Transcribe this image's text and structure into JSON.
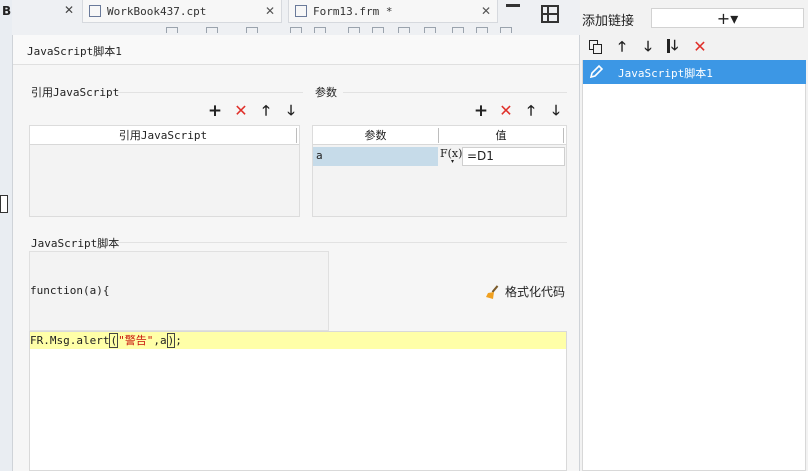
{
  "background": {
    "tabs": [
      {
        "label": "WorkBook437.cpt",
        "close": "✕"
      },
      {
        "label": "Form13.frm *",
        "close": "✕"
      }
    ],
    "left_letter": "B",
    "left_close": "✕"
  },
  "dialog": {
    "title": "JavaScript脚本1",
    "ref_section": {
      "label": "引用JavaScript",
      "column_header": "引用JavaScript"
    },
    "param_section": {
      "label": "参数",
      "columns": [
        "参数",
        "值"
      ],
      "rows": [
        {
          "name": "a",
          "formula_icon": "F(x)",
          "value": "=D1"
        }
      ]
    },
    "script_section": {
      "label": "JavaScript脚本",
      "function_header": "function(a){",
      "format_button": "格式化代码",
      "code_line": {
        "before": "FR.Msg.alert",
        "open_paren": "(",
        "string": "\"警告\"",
        "comma": ",a",
        "close_paren": ")",
        "end": ";"
      }
    }
  },
  "right_panel": {
    "add_link_label": "添加链接",
    "add_button_glyph": "+▾",
    "toolbar_icons": [
      "copy-icon",
      "arrow-up-icon",
      "arrow-down-icon",
      "move-bottom-icon",
      "delete-icon"
    ],
    "items": [
      {
        "label": "JavaScript脚本1",
        "selected": true
      }
    ]
  },
  "colors": {
    "selection": "#3c97e5",
    "delete_red": "#e0302a",
    "param_cell": "#c6dbe9",
    "code_highlight": "#ffffa8"
  }
}
